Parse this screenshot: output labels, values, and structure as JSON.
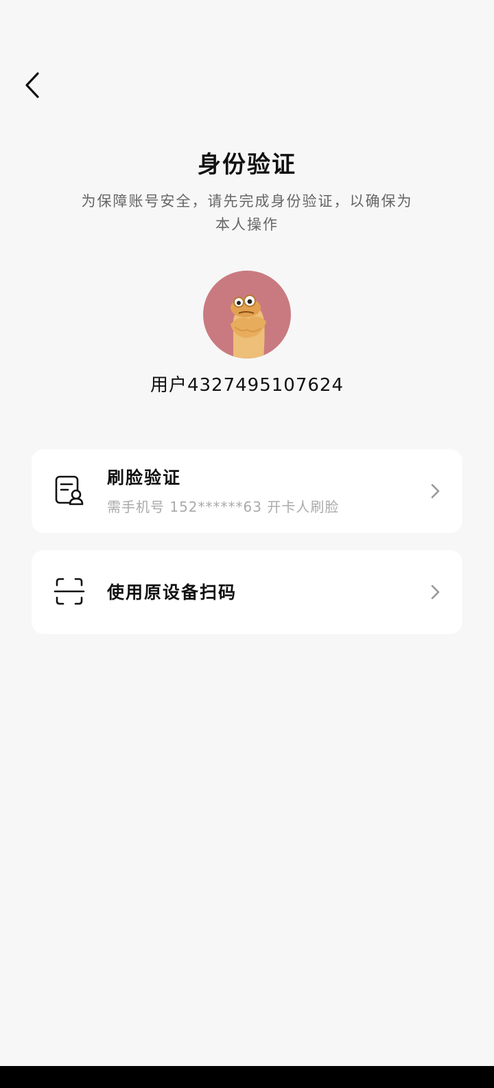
{
  "header": {
    "title": "身份验证",
    "subtitle": "为保障账号安全，请先完成身份验证，以确保为本人操作"
  },
  "user": {
    "name": "用户4327495107624",
    "avatar_icon": "cartoon-character-avatar"
  },
  "options": [
    {
      "title": "刷脸验证",
      "description": "需手机号 152******63 开卡人刷脸",
      "icon": "face-id-document-icon"
    },
    {
      "title": "使用原设备扫码",
      "icon": "scan-icon"
    }
  ],
  "colors": {
    "background": "#f7f7f7",
    "card": "#ffffff",
    "avatar_bg": "#c97a80",
    "primary_text": "#111111",
    "secondary_text": "#aaaaaa"
  }
}
